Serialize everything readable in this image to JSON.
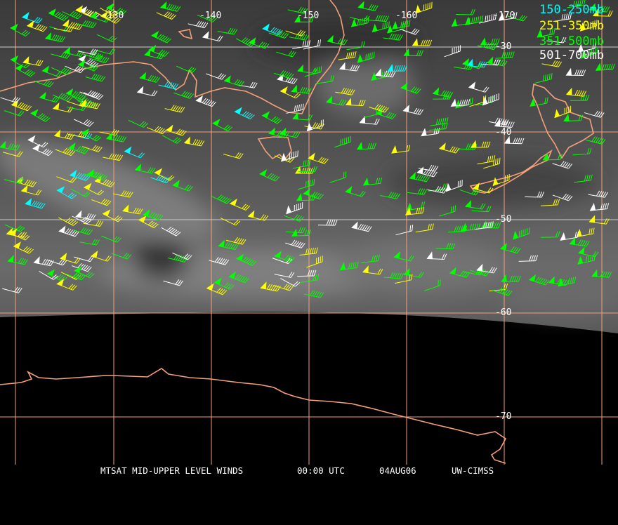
{
  "title": "MTSAT MID-UPPER LEVEL WINDS",
  "time": "00:00 UTC",
  "date": "04AUG06",
  "credit": "UW-CIMSS",
  "legend": [
    {
      "label": "150-250mb",
      "color": "#00ffff"
    },
    {
      "label": "251-350mb",
      "color": "#ffff00"
    },
    {
      "label": "351-500mb",
      "color": "#00ff00"
    },
    {
      "label": "501-700mb",
      "color": "#ffffff"
    }
  ],
  "longitude_labels": [
    "-130",
    "-140",
    "-150",
    "-160",
    "-170"
  ],
  "latitude_labels": [
    "-30",
    "-40",
    "-50",
    "-60",
    "-70"
  ],
  "colors": {
    "coastline": "#f4a07a",
    "grid": "#f4a07a",
    "background": "#000000"
  }
}
